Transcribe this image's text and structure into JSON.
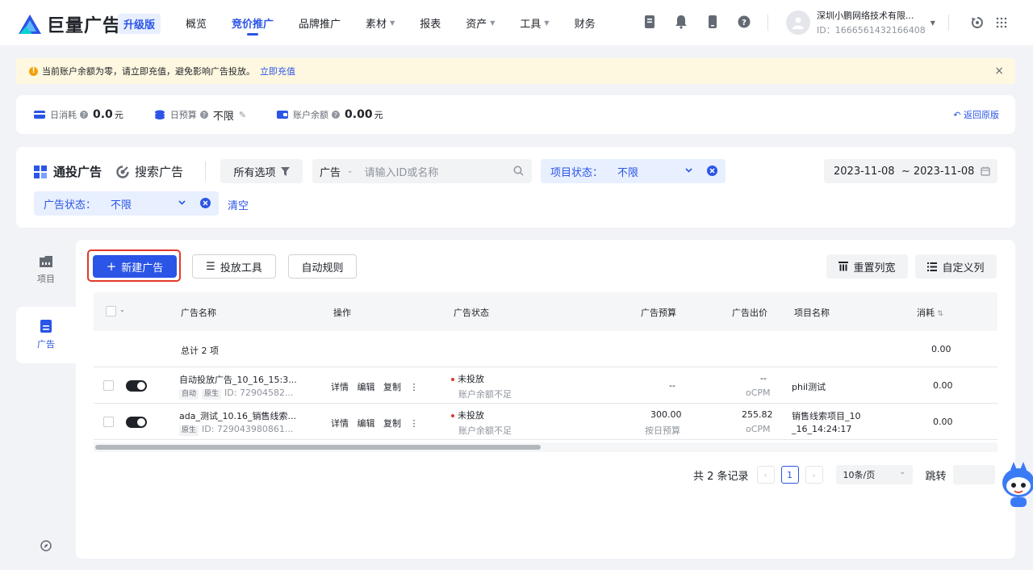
{
  "brand": {
    "name": "巨量广告",
    "upgrade": "升级版"
  },
  "nav": [
    {
      "label": "概览",
      "caret": false,
      "active": false
    },
    {
      "label": "竞价推广",
      "caret": false,
      "active": true
    },
    {
      "label": "品牌推广",
      "caret": false,
      "active": false
    },
    {
      "label": "素材",
      "caret": true,
      "active": false
    },
    {
      "label": "报表",
      "caret": false,
      "active": false
    },
    {
      "label": "资产",
      "caret": true,
      "active": false
    },
    {
      "label": "工具",
      "caret": true,
      "active": false
    },
    {
      "label": "财务",
      "caret": false,
      "active": false
    }
  ],
  "account": {
    "name": "深圳小鹏网络技术有限...",
    "id": "ID：1666561432166408"
  },
  "notice": {
    "text": "当前账户余额为零，请立即充值，避免影响广告投放。",
    "link": "立即充值"
  },
  "stats": {
    "daily_spend_label": "日消耗",
    "daily_spend_value": "0.0",
    "daily_spend_unit": "元",
    "daily_budget_label": "日预算",
    "daily_budget_value": "不限",
    "balance_label": "账户余额",
    "balance_value": "0.00",
    "balance_unit": "元",
    "back_link": "返回原版"
  },
  "filters": {
    "tab_tongtou": "通投广告",
    "tab_search": "搜索广告",
    "all_options": "所有选项",
    "ad_select": "广告",
    "search_placeholder": "请输入ID或名称",
    "project_status_label": "项目状态：",
    "project_status_value": "不限",
    "date_range": "2023-11-08  ~ 2023-11-08",
    "ad_status_label": "广告状态：",
    "ad_status_value": "不限",
    "clear": "清空"
  },
  "rail": {
    "project": "项目",
    "ad": "广告"
  },
  "toolbar": {
    "new_ad": "新建广告",
    "delivery_tools": "投放工具",
    "auto_rules": "自动规则",
    "reset_width": "重置列宽",
    "custom_columns": "自定义列"
  },
  "table": {
    "headers": {
      "name": "广告名称",
      "ops": "操作",
      "status": "广告状态",
      "budget": "广告预算",
      "bid": "广告出价",
      "project": "项目名称",
      "spend": "消耗"
    },
    "total_label": "总计 2 项",
    "total_spend": "0.00",
    "rows": [
      {
        "name": "自动投放广告_10_16_15:3...",
        "tags": [
          "自动",
          "原生"
        ],
        "id": "ID: 72904582...",
        "ops": [
          "详情",
          "编辑",
          "复制"
        ],
        "status": "未投放",
        "status_sub": "账户余额不足",
        "budget": "--",
        "budget_sub": "",
        "bid": "--",
        "bid_sub": "oCPM",
        "project": "phil测试",
        "project2": "",
        "spend": "0.00"
      },
      {
        "name": "ada_测试_10.16_销售线索...",
        "tags": [
          "原生"
        ],
        "id": "ID: 729043980861...",
        "ops": [
          "详情",
          "编辑",
          "复制"
        ],
        "status": "未投放",
        "status_sub": "账户余额不足",
        "budget": "300.00",
        "budget_sub": "按日预算",
        "bid": "255.82",
        "bid_sub": "oCPM",
        "project": "销售线索项目_10",
        "project2": "_16_14:24:17",
        "spend": "0.00"
      }
    ]
  },
  "pagination": {
    "total": "共 2 条记录",
    "current": "1",
    "page_size": "10条/页",
    "jump": "跳转"
  },
  "colors": {
    "primary": "#2b55e6",
    "danger": "#e2392a",
    "warning_bg": "#fff8e0"
  }
}
